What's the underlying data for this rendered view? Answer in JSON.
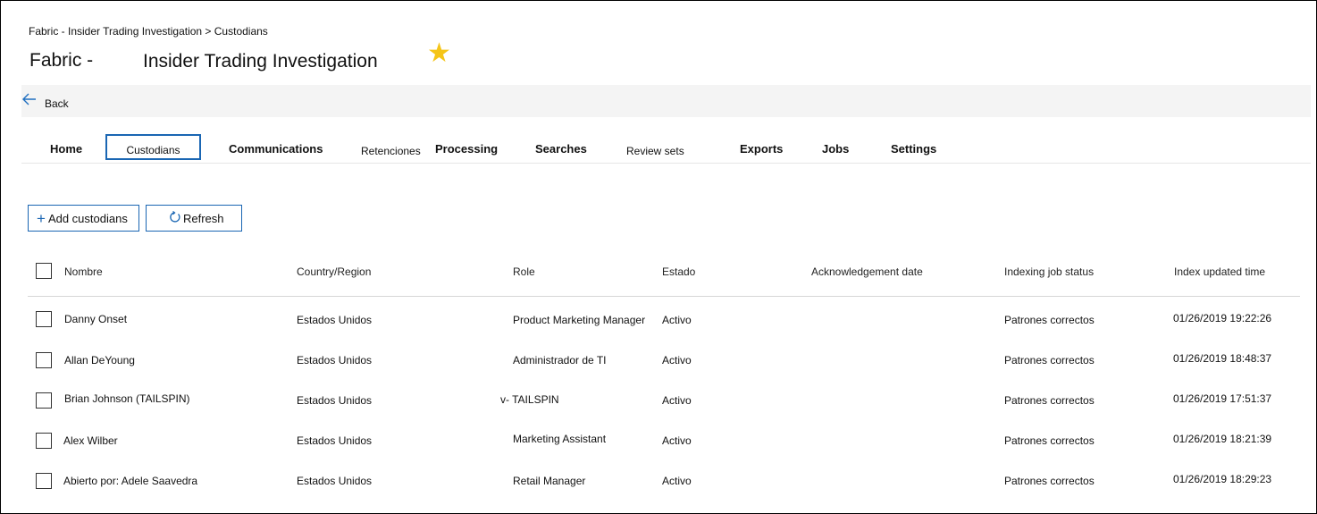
{
  "breadcrumb": "Fabric - Insider Trading Investigation > Custodians",
  "title": {
    "prefix": "Fabric -",
    "name": "Insider Trading Investigation",
    "favorite_icon": "star-icon",
    "favorite_color": "#f5c518"
  },
  "back": {
    "icon": "arrow-left-icon",
    "label": "Back"
  },
  "tabs": [
    {
      "label": "Home"
    },
    {
      "label": "Custodians",
      "active": true
    },
    {
      "label": "Communications"
    },
    {
      "label": "Retenciones"
    },
    {
      "label": "Processing"
    },
    {
      "label": "Searches"
    },
    {
      "label": "Review sets"
    },
    {
      "label": "Exports"
    },
    {
      "label": "Jobs"
    },
    {
      "label": "Settings"
    }
  ],
  "toolbar": {
    "add_label": "Add custodians",
    "add_icon": "plus-icon",
    "refresh_label": "Refresh",
    "refresh_icon": "refresh-icon"
  },
  "table": {
    "columns": [
      "Nombre",
      "Country/Region",
      "Role",
      "Estado",
      "Acknowledgement date",
      "Indexing job status",
      "Index updated time"
    ],
    "rows": [
      {
        "name": "Danny Onset",
        "country": "Estados Unidos",
        "role": "Product Marketing Manager",
        "estado": "Activo",
        "ack": "",
        "indexing": "Patrones correctos",
        "updated": "01/26/2019 19:22:26"
      },
      {
        "name": "Allan DeYoung",
        "country": "Estados Unidos",
        "role": "Administrador de TI",
        "estado": "Activo",
        "ack": "",
        "indexing": "Patrones correctos",
        "updated": "01/26/2019 18:48:37"
      },
      {
        "name": "Brian Johnson (TAILSPIN)",
        "country": "Estados Unidos",
        "role": "v- TAILSPIN",
        "estado": "Activo",
        "ack": "",
        "indexing": "Patrones correctos",
        "updated": "01/26/2019 17:51:37"
      },
      {
        "name": "Alex Wilber",
        "country": "Estados Unidos",
        "role": "Marketing Assistant",
        "estado": "Activo",
        "ack": "",
        "indexing": "Patrones correctos",
        "updated": "01/26/2019 18:21:39"
      },
      {
        "name": "Abierto por: Adele Saavedra",
        "country": "Estados Unidos",
        "role": "Retail Manager",
        "estado": "Activo",
        "ack": "",
        "indexing": "Patrones correctos",
        "updated": "01/26/2019 18:29:23"
      }
    ]
  }
}
